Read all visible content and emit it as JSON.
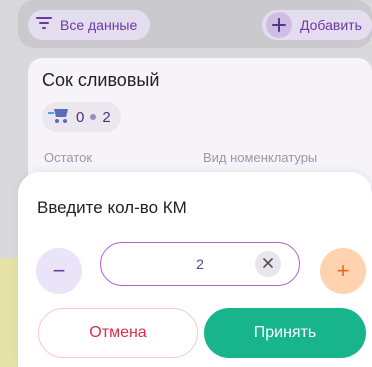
{
  "toolbar": {
    "filter_label": "Все данные",
    "add_label": "Добавить"
  },
  "card": {
    "title": "Сок сливовый",
    "qty_left": "0",
    "qty_right": "2",
    "label_left": "Остаток",
    "label_right": "Вид номенклатуры"
  },
  "dialog": {
    "title": "Введите кол-во КМ",
    "value": "2",
    "minus_label": "−",
    "plus_label": "+",
    "cancel_label": "Отмена",
    "accept_label": "Принять"
  },
  "colors": {
    "accent_purple": "#6b3aa3",
    "accept_green": "#18b48c",
    "cancel_red": "#e22a4a",
    "plus_orange": "#f0641e"
  }
}
